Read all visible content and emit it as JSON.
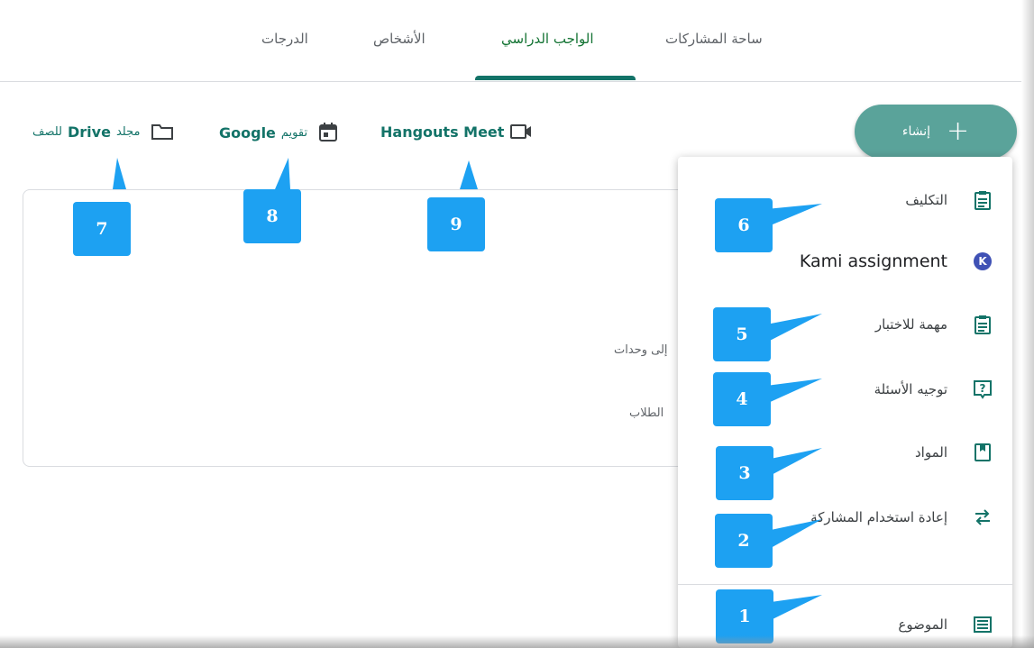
{
  "tabs": [
    {
      "label": "ساحة المشاركات"
    },
    {
      "label": "الواجب الدراسي"
    },
    {
      "label": "الأشخاص"
    },
    {
      "label": "الدرجات"
    }
  ],
  "toolbar": {
    "meet": {
      "label": "Hangouts Meet"
    },
    "calendar": {
      "ar": "تقويم",
      "en": "Google"
    },
    "drive": {
      "en": "Drive",
      "ar_prefix": "مجلد",
      "ar_suffix": "للصف"
    }
  },
  "create_button": {
    "label": "إنشاء",
    "plus": "+"
  },
  "card": {
    "line1": "إلى وحدات",
    "line2": "الطلاب"
  },
  "menu": {
    "items": [
      {
        "label": "التكليف",
        "icon": "assignment-icon"
      },
      {
        "label": "Kami assignment",
        "icon": "kami-icon",
        "icon_glyph": "K"
      },
      {
        "label": "مهمة للاختبار",
        "icon": "quiz-assignment-icon"
      },
      {
        "label": "توجيه الأسئلة",
        "icon": "question-icon"
      },
      {
        "label": "المواد",
        "icon": "material-icon"
      },
      {
        "label": "إعادة استخدام المشاركة",
        "icon": "reuse-post-icon"
      },
      {
        "label": "الموضوع",
        "icon": "topic-icon"
      }
    ]
  },
  "callouts": [
    "1",
    "2",
    "3",
    "4",
    "5",
    "6",
    "7",
    "8",
    "9"
  ],
  "colors": {
    "accent": "#137368",
    "callout": "#1da1f2",
    "create_button": "#5aa39a",
    "kami": "#3f51b5"
  }
}
